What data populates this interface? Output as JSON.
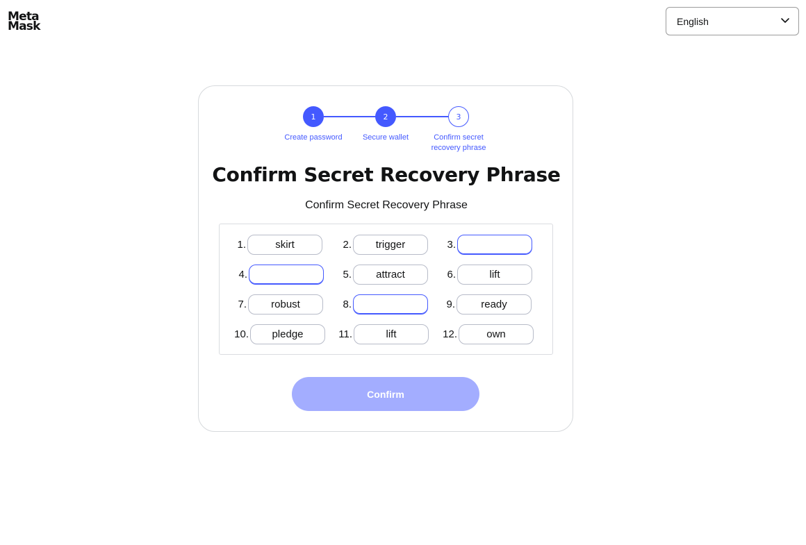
{
  "header": {
    "logo_line1": "Meta",
    "logo_line2": "Mask",
    "language": "English"
  },
  "stepper": {
    "steps": [
      {
        "number": "1",
        "label": "Create password",
        "state": "complete"
      },
      {
        "number": "2",
        "label": "Secure wallet",
        "state": "complete"
      },
      {
        "number": "3",
        "label": "Confirm secret recovery phrase",
        "state": "current"
      }
    ],
    "accent_color": "#4459ff"
  },
  "page": {
    "title": "Confirm Secret Recovery Phrase",
    "subtitle": "Confirm Secret Recovery Phrase"
  },
  "phrase": [
    {
      "num": "1.",
      "word": "skirt"
    },
    {
      "num": "2.",
      "word": "trigger"
    },
    {
      "num": "3.",
      "word": ""
    },
    {
      "num": "4.",
      "word": ""
    },
    {
      "num": "5.",
      "word": "attract"
    },
    {
      "num": "6.",
      "word": "lift"
    },
    {
      "num": "7.",
      "word": "robust"
    },
    {
      "num": "8.",
      "word": ""
    },
    {
      "num": "9.",
      "word": "ready"
    },
    {
      "num": "10.",
      "word": "pledge"
    },
    {
      "num": "11.",
      "word": "lift"
    },
    {
      "num": "12.",
      "word": "own"
    }
  ],
  "actions": {
    "confirm_label": "Confirm",
    "confirm_disabled": true
  }
}
